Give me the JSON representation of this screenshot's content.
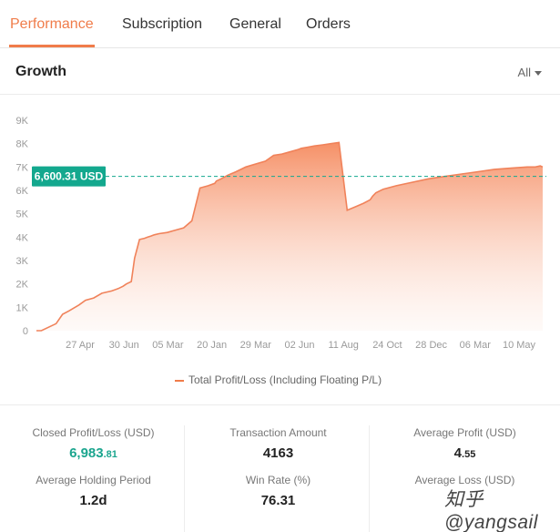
{
  "tabs": [
    "Performance",
    "Subscription",
    "General",
    "Orders"
  ],
  "section": {
    "title": "Growth",
    "range": "All"
  },
  "colors": {
    "accent": "#f07c4a",
    "line": "#f0825a",
    "reference": "#13a88e",
    "positive": "#1ba58e"
  },
  "chart_data": {
    "type": "area",
    "y_ticks": [
      "0",
      "1K",
      "2K",
      "3K",
      "4K",
      "5K",
      "6K",
      "7K",
      "8K",
      "9K"
    ],
    "ylim": [
      0,
      9000
    ],
    "x_ticks": [
      "27 Apr",
      "30 Jun",
      "05 Mar",
      "20 Jan",
      "29 Mar",
      "02 Jun",
      "11 Aug",
      "24 Oct",
      "28 Dec",
      "06 Mar",
      "10 May"
    ],
    "x": [
      0,
      0.3,
      1.2,
      1.6,
      2.0,
      2.6,
      3.0,
      3.5,
      4.0,
      4.6,
      5.0,
      5.3,
      5.5,
      5.8,
      6.0,
      6.3,
      6.6,
      6.8,
      7.0,
      7.2,
      7.5,
      8.0,
      8.5,
      9.0,
      9.5,
      10.0,
      10.5,
      10.9,
      11.0,
      11.3,
      11.7,
      12.2,
      12.5,
      12.8,
      13.5,
      14.0,
      14.5,
      15.0,
      15.5,
      16.0,
      16.2,
      16.6,
      17.0,
      17.5,
      18.0,
      18.5,
      19.0,
      19.5,
      20.0,
      20.4,
      20.55,
      20.75,
      21.2,
      22.0,
      23.0,
      24.0,
      25.0,
      26.0,
      27.0,
      28.0,
      29.0,
      30.0,
      30.5,
      30.8,
      30.95
    ],
    "y": [
      0,
      0,
      300,
      700,
      850,
      1100,
      1300,
      1400,
      1600,
      1700,
      1800,
      1900,
      2000,
      2100,
      3100,
      3900,
      3950,
      4000,
      4050,
      4100,
      4150,
      4200,
      4300,
      4400,
      4700,
      6100,
      6200,
      6300,
      6400,
      6500,
      6650,
      6800,
      6900,
      7000,
      7150,
      7250,
      7500,
      7550,
      7650,
      7750,
      7800,
      7850,
      7900,
      7950,
      8000,
      8050,
      5150,
      5300,
      5450,
      5600,
      5750,
      5900,
      6050,
      6200,
      6350,
      6500,
      6600,
      6700,
      6800,
      6900,
      6950,
      7000,
      7000,
      7050,
      7000,
      6600
    ],
    "reference": {
      "value": 6600.31,
      "label": "6,600.31 USD"
    },
    "legend": "Total Profit/Loss (Including Floating P/L)",
    "grid": false
  },
  "stats": {
    "closed_pl": {
      "label": "Closed Profit/Loss (USD)",
      "int": "6,983",
      "dec": ".81"
    },
    "transaction_amount": {
      "label": "Transaction Amount",
      "value": "4163"
    },
    "average_profit": {
      "label": "Average Profit (USD)",
      "int": "4",
      "dec": ".55"
    },
    "holding_period": {
      "label": "Average Holding Period",
      "value": "1.2d"
    },
    "win_rate": {
      "label": "Win Rate (%)",
      "value": "76.31"
    },
    "average_loss": {
      "label": "Average Loss (USD)"
    }
  },
  "watermark": "知乎 @yangsail"
}
